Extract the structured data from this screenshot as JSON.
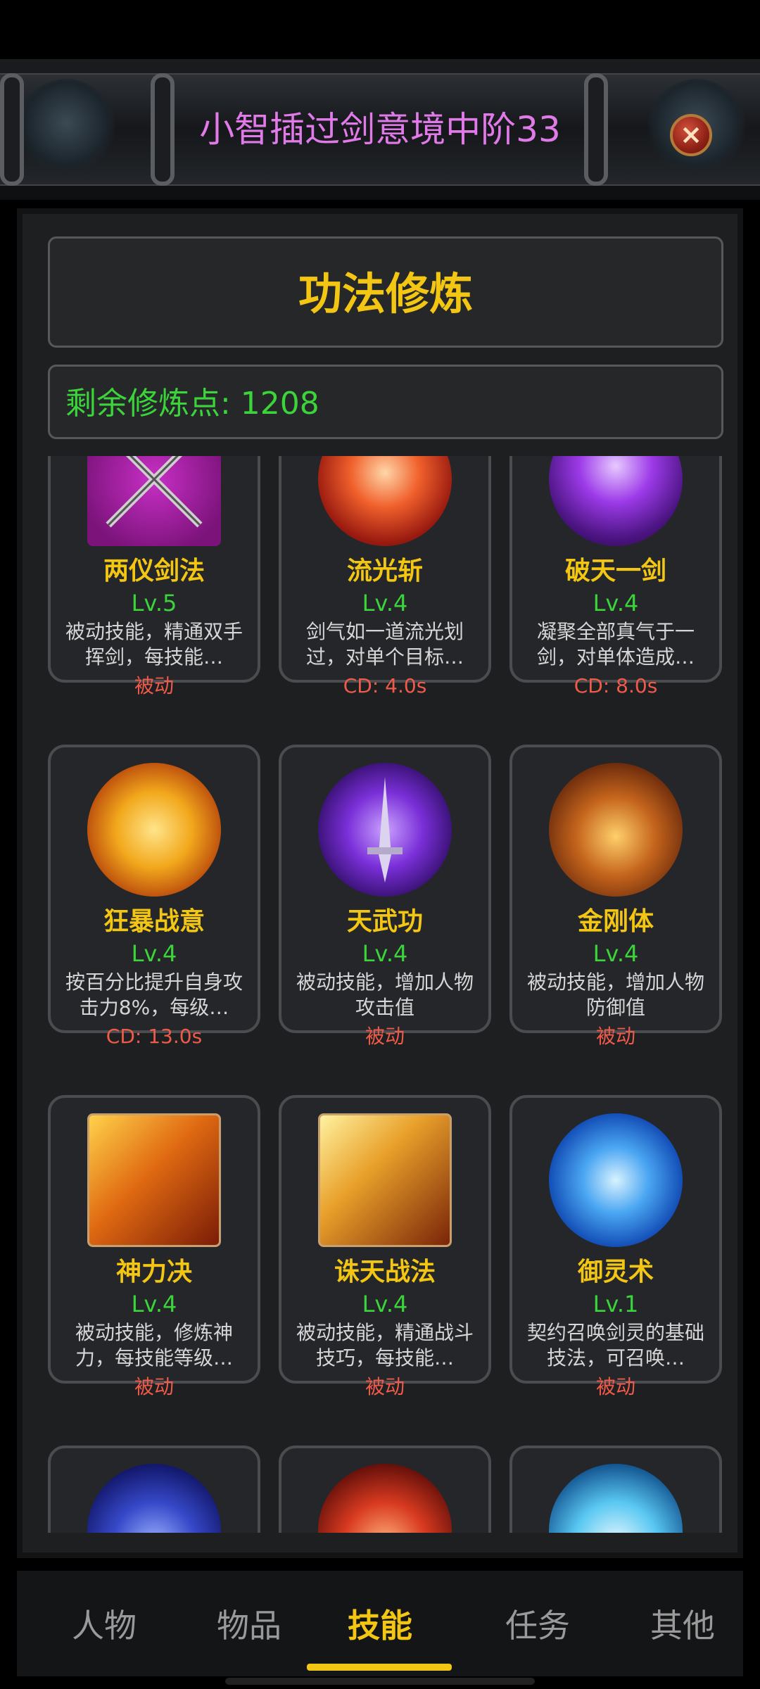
{
  "header": {
    "title": "小智插过剑意境中阶33",
    "close_icon": "close-icon"
  },
  "panel": {
    "title": "功法修炼",
    "points_label": "剩余修炼点: 1208"
  },
  "skills": [
    {
      "name": "两仪剑法",
      "level": "Lv.5",
      "desc": "被动技能，精通双手挥剑，每技能…",
      "type": "被动",
      "icon": "crossed-swords-icon"
    },
    {
      "name": "流光斩",
      "level": "Lv.4",
      "desc": "剑气如一道流光划过，对单个目标…",
      "type": "CD: 4.0s",
      "icon": "flame-slash-icon"
    },
    {
      "name": "破天一剑",
      "level": "Lv.4",
      "desc": "凝聚全部真气于一剑，对单体造成…",
      "type": "CD: 8.0s",
      "icon": "lightning-icon"
    },
    {
      "name": "狂暴战意",
      "level": "Lv.4",
      "desc": "按百分比提升自身攻击力8%，每级…",
      "type": "CD: 13.0s",
      "icon": "fist-icon"
    },
    {
      "name": "天武功",
      "level": "Lv.4",
      "desc": "被动技能，增加人物攻击值",
      "type": "被动",
      "icon": "sword-icon"
    },
    {
      "name": "金刚体",
      "level": "Lv.4",
      "desc": "被动技能，增加人物防御值",
      "type": "被动",
      "icon": "guardian-icon"
    },
    {
      "name": "神力决",
      "level": "Lv.4",
      "desc": "被动技能，修炼神力，每技能等级…",
      "type": "被动",
      "icon": "blade-icon"
    },
    {
      "name": "诛天战法",
      "level": "Lv.4",
      "desc": "被动技能，精通战斗技巧，每技能…",
      "type": "被动",
      "icon": "spear-icon"
    },
    {
      "name": "御灵术",
      "level": "Lv.1",
      "desc": "契约召唤剑灵的基础技法，可召唤…",
      "type": "被动",
      "icon": "spirit-dragon-icon"
    }
  ],
  "tabs": [
    "人物",
    "物品",
    "技能",
    "任务",
    "其他"
  ],
  "active_tab": "技能",
  "colors": {
    "title_gold": "#f2c613",
    "level_green": "#3bd43a",
    "type_red": "#f05a4a",
    "header_pink": "#e07ae8"
  }
}
